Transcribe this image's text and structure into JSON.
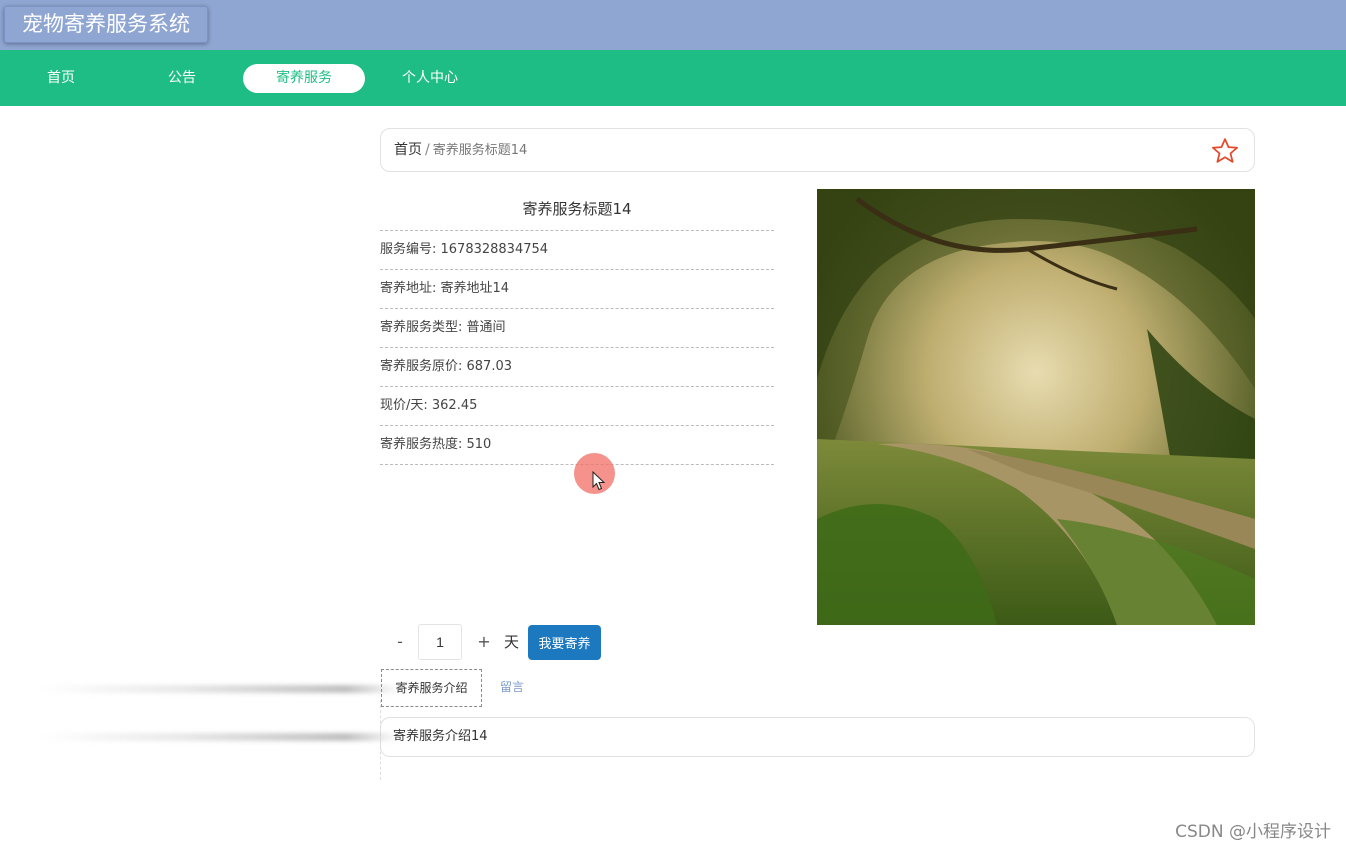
{
  "app": {
    "title": "宠物寄养服务系统"
  },
  "nav": {
    "items": [
      "首页",
      "公告",
      "寄养服务",
      "个人中心"
    ],
    "active_index": 2
  },
  "breadcrumb": {
    "home": "首页",
    "separator": "/",
    "current": "寄养服务标题14"
  },
  "detail": {
    "title": "寄养服务标题14",
    "rows": [
      "服务编号: 1678328834754",
      "寄养地址: 寄养地址14",
      "寄养服务类型: 普通间",
      "寄养服务原价: 687.03",
      "现价/天: 362.45",
      "寄养服务热度: 510"
    ]
  },
  "booking": {
    "minus": "-",
    "quantity": "1",
    "plus": "+",
    "unit": "天",
    "book_label": "我要寄养"
  },
  "tabs": [
    {
      "label": "寄养服务介绍"
    },
    {
      "label": "留言"
    }
  ],
  "tab_content": "寄养服务介绍14",
  "watermark": "CSDN @小程序设计",
  "colors": {
    "header": "#8fa6d2",
    "nav": "#1fbd86",
    "button": "#1d79bf",
    "star": "#e34a2c"
  },
  "icons": {
    "favorite": "star-outline-icon",
    "cursor": "mouse-cursor-icon"
  }
}
